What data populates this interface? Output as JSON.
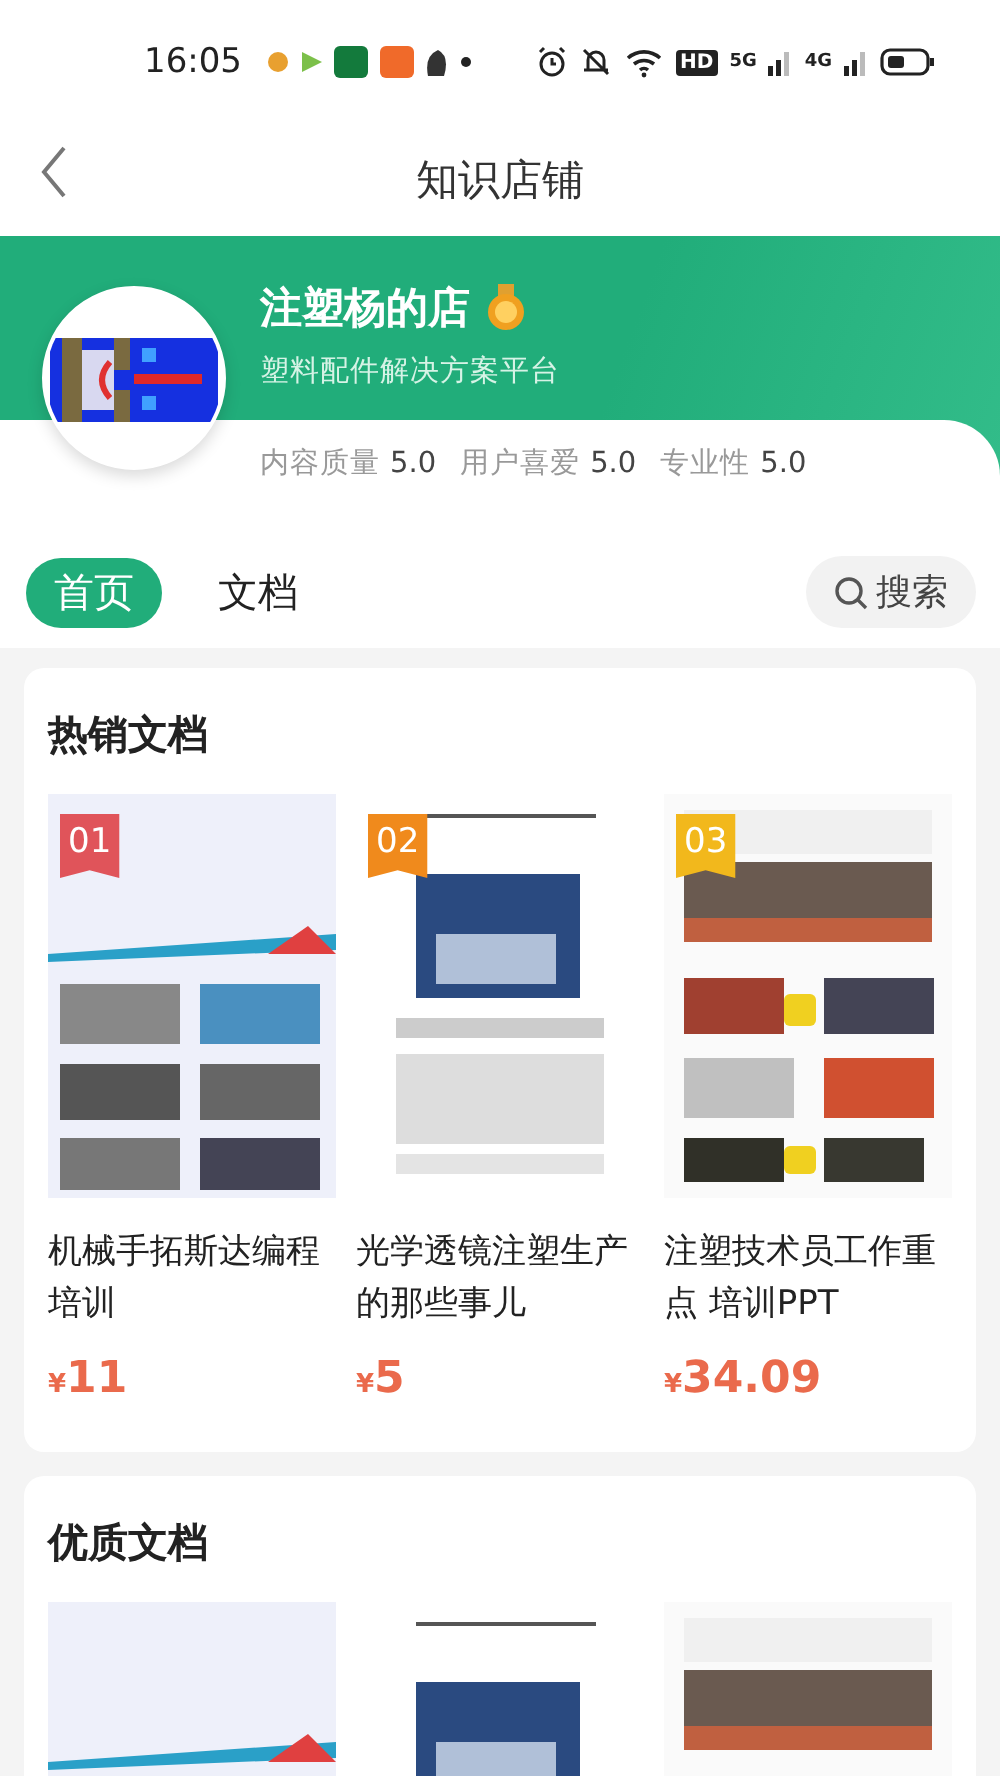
{
  "status_bar": {
    "time": "16:05",
    "network_labels": [
      "HD",
      "5G",
      "4G"
    ]
  },
  "header": {
    "title": "知识店铺"
  },
  "shop": {
    "name": "注塑杨的店",
    "subtitle": "塑料配件解决方案平台",
    "ratings": [
      {
        "label": "内容质量",
        "value": "5.0"
      },
      {
        "label": "用户喜爱",
        "value": "5.0"
      },
      {
        "label": "专业性",
        "value": "5.0"
      }
    ]
  },
  "tabs": [
    {
      "label": "首页",
      "selected": true
    },
    {
      "label": "文档",
      "selected": false
    }
  ],
  "search": {
    "label": "搜索"
  },
  "sections": [
    {
      "title": "热销文档",
      "documents": [
        {
          "rank": "01",
          "color": "#e0545a",
          "title": "机械手拓斯达编程培训",
          "currency": "¥",
          "price": "11",
          "kind": "picture"
        },
        {
          "rank": "02",
          "color": "#f08a1c",
          "title": "光学透镜注塑生产的那些事儿",
          "currency": "¥",
          "price": "5",
          "kind": "picture"
        },
        {
          "rank": "03",
          "color": "#f2b81c",
          "title": "注塑技术员工作重点 培训PPT",
          "currency": "¥",
          "price": "34.09",
          "kind": "picture"
        }
      ]
    },
    {
      "title": "优质文档"
    }
  ]
}
